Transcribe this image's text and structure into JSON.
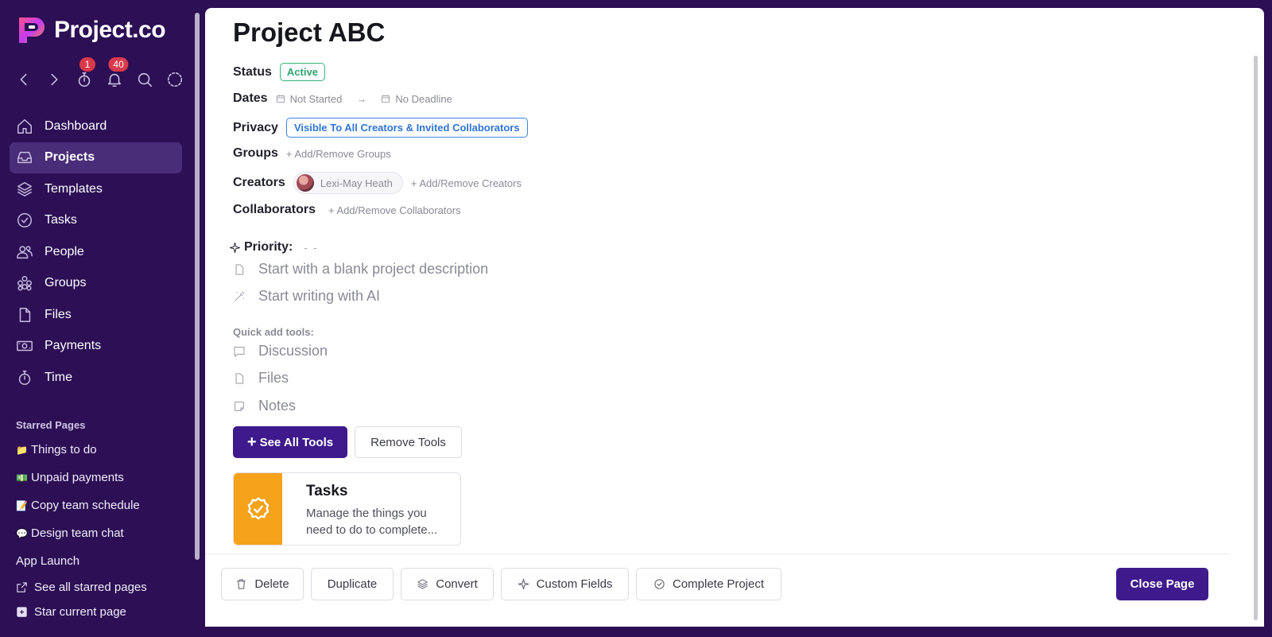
{
  "app": {
    "name": "Project.co",
    "brand_color": "#2c0f55",
    "accent_color": "#3e1a8c"
  },
  "toolbar": {
    "timer_badge": "1",
    "notifications_badge": "40"
  },
  "nav": {
    "items": [
      {
        "label": "Dashboard",
        "icon": "home-icon"
      },
      {
        "label": "Projects",
        "icon": "inbox-icon",
        "active": true
      },
      {
        "label": "Templates",
        "icon": "layers-icon"
      },
      {
        "label": "Tasks",
        "icon": "check-badge-icon"
      },
      {
        "label": "People",
        "icon": "people-icon"
      },
      {
        "label": "Groups",
        "icon": "groups-icon"
      },
      {
        "label": "Files",
        "icon": "file-icon"
      },
      {
        "label": "Payments",
        "icon": "money-icon"
      },
      {
        "label": "Time",
        "icon": "stopwatch-icon"
      }
    ]
  },
  "starred": {
    "title": "Starred Pages",
    "items": [
      {
        "emoji": "📁",
        "label": "Things to do"
      },
      {
        "emoji": "💵",
        "label": "Unpaid payments"
      },
      {
        "emoji": "📝",
        "label": "Copy team schedule"
      },
      {
        "emoji": "💬",
        "label": "Design team chat"
      },
      {
        "emoji": "",
        "label": "App Launch"
      }
    ],
    "see_all": "See all starred pages",
    "star_current": "Star current page"
  },
  "project": {
    "title": "Project ABC",
    "status_label": "Status",
    "status_value": "Active",
    "dates_label": "Dates",
    "start_date": "Not Started",
    "deadline": "No Deadline",
    "privacy_label": "Privacy",
    "privacy_value": "Visible To All Creators & Invited Collaborators",
    "groups_label": "Groups",
    "groups_action": "+ Add/Remove Groups",
    "creators_label": "Creators",
    "creator_name": "Lexi-May Heath",
    "creators_action": "+ Add/Remove Creators",
    "collaborators_label": "Collaborators",
    "collaborators_action": "+ Add/Remove Collaborators",
    "priority_label": "Priority:",
    "priority_value": "- -",
    "blank_description": "Start with a blank project description",
    "write_ai": "Start writing with AI",
    "quick_add_label": "Quick add tools:",
    "quick_tools": [
      "Discussion",
      "Files",
      "Notes"
    ],
    "see_all_tools": "See All Tools",
    "remove_tools": "Remove Tools",
    "tool_card": {
      "title": "Tasks",
      "description": "Manage the things you need to do to complete..."
    }
  },
  "footer": {
    "delete": "Delete",
    "duplicate": "Duplicate",
    "convert": "Convert",
    "custom_fields": "Custom Fields",
    "complete": "Complete Project",
    "close": "Close Page"
  }
}
